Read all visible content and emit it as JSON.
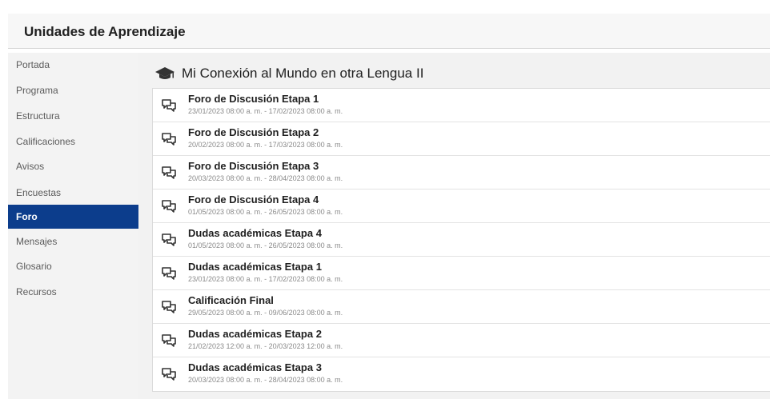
{
  "header": {
    "title": "Unidades de Aprendizaje"
  },
  "sidebar": {
    "items": [
      {
        "label": "Portada"
      },
      {
        "label": "Programa"
      },
      {
        "label": "Estructura"
      },
      {
        "label": "Calificaciones"
      },
      {
        "label": "Avisos"
      },
      {
        "label": "Encuestas"
      },
      {
        "label": "Foro",
        "active": true
      },
      {
        "label": "Mensajes"
      },
      {
        "label": "Glosario"
      },
      {
        "label": "Recursos"
      }
    ]
  },
  "main": {
    "icon": "graduation-cap-icon",
    "title": "Mi Conexión al Mundo en otra Lengua II",
    "forums": [
      {
        "name": "Foro de Discusión Etapa 1",
        "dates": "23/01/2023 08:00 a. m. - 17/02/2023 08:00 a. m.",
        "icon": "chat-bubbles-icon"
      },
      {
        "name": "Foro de Discusión Etapa 2",
        "dates": "20/02/2023 08:00 a. m. - 17/03/2023 08:00 a. m.",
        "icon": "chat-bubbles-icon"
      },
      {
        "name": "Foro de Discusión Etapa 3",
        "dates": "20/03/2023 08:00 a. m. - 28/04/2023 08:00 a. m.",
        "icon": "chat-bubbles-icon"
      },
      {
        "name": "Foro de Discusión Etapa 4",
        "dates": "01/05/2023 08:00 a. m. - 26/05/2023 08:00 a. m.",
        "icon": "chat-bubbles-icon"
      },
      {
        "name": "Dudas académicas Etapa 4",
        "dates": "01/05/2023 08:00 a. m. - 26/05/2023 08:00 a. m.",
        "icon": "chat-bubbles-icon"
      },
      {
        "name": "Dudas académicas Etapa 1",
        "dates": "23/01/2023 08:00 a. m. - 17/02/2023 08:00 a. m.",
        "icon": "chat-bubbles-icon"
      },
      {
        "name": "Calificación Final",
        "dates": "29/05/2023 08:00 a. m. - 09/06/2023 08:00 a. m.",
        "icon": "chat-bubbles-icon"
      },
      {
        "name": "Dudas académicas Etapa 2",
        "dates": "21/02/2023 12:00 a. m. - 20/03/2023 12:00 a. m.",
        "icon": "chat-bubbles-icon"
      },
      {
        "name": "Dudas académicas Etapa 3",
        "dates": "20/03/2023 08:00 a. m. - 28/04/2023 08:00 a. m.",
        "icon": "chat-bubbles-icon"
      }
    ]
  },
  "colors": {
    "active_nav": "#0c3d8c",
    "sidebar_bg": "#f3f3f3",
    "main_bg": "#f2f2f2"
  }
}
